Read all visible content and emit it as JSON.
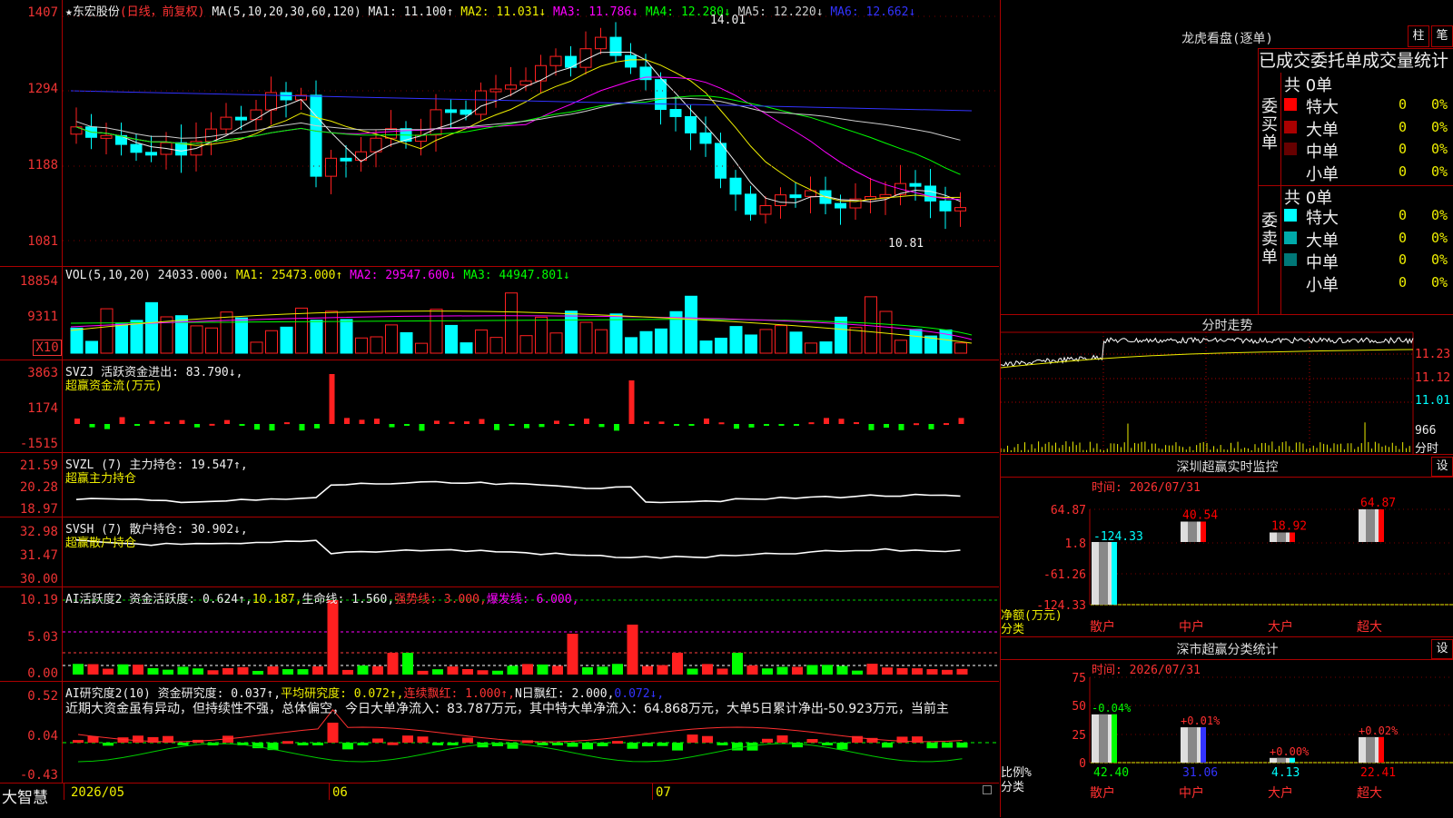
{
  "stock": {
    "star": "★",
    "name": "东宏股份",
    "mode": "(日线，前复权)"
  },
  "main": {
    "ma_prefix": "MA(5,10,20,30,60,120)",
    "ma": [
      {
        "label": "MA1:",
        "value": "11.100↑",
        "color": "#eeeeee"
      },
      {
        "label": "MA2:",
        "value": "11.031↓",
        "color": "#eeee00"
      },
      {
        "label": "MA3:",
        "value": "11.786↓",
        "color": "#ff00ff"
      },
      {
        "label": "MA4:",
        "value": "12.280↓",
        "color": "#00ff00"
      },
      {
        "label": "MA5:",
        "value": "12.220↓",
        "color": "#cccccc"
      },
      {
        "label": "MA6:",
        "value": "12.662↓",
        "color": "#3333ff"
      }
    ],
    "y_labels": [
      "1407",
      "1294",
      "1188",
      "1081"
    ],
    "high_note": "14.01",
    "low_note": "10.81"
  },
  "vol": {
    "legend_prefix": "VOL(5,10,20)",
    "legend_val": "24033.000↓",
    "ma": [
      {
        "label": "MA1:",
        "value": "25473.000↑",
        "color": "#eeee00"
      },
      {
        "label": "MA2:",
        "value": "29547.600↓",
        "color": "#ff00ff"
      },
      {
        "label": "MA3:",
        "value": "44947.801↓",
        "color": "#00ff00"
      }
    ],
    "y_labels": [
      "18854",
      "9311"
    ],
    "unit": "X10"
  },
  "svzj": {
    "legend": "SVZJ  活跃资金进出: 83.790↓,",
    "sub": "超赢资金流(万元)",
    "y_labels": [
      "3863",
      "1174",
      "-1515"
    ]
  },
  "svzl": {
    "legend": "SVZL (7) 主力持仓: 19.547↑,",
    "sub": "超赢主力持仓",
    "y_labels": [
      "21.59",
      "20.28",
      "18.97"
    ]
  },
  "svsh": {
    "legend": "SVSH (7) 散户持仓: 30.902↓,",
    "sub": "超赢散户持仓",
    "y_labels": [
      "32.98",
      "31.47",
      "30.00"
    ]
  },
  "ai_active": {
    "legend_a": "AI活跃度2 资金活跃度: 0.624↑,",
    "legend_b": "10.187,",
    "legend_c": "生命线: 1.560,",
    "legend_d": "强势线: 3.000,",
    "legend_e": "爆发线: 6.000,",
    "y_labels": [
      "10.19",
      "5.03",
      "0.00"
    ]
  },
  "ai_research": {
    "legend_a": "AI研究度2(10) 资金研究度: 0.037↑,",
    "legend_b": "平均研究度: 0.072↑,",
    "legend_c": "连续飘红: 1.000↑,",
    "legend_d": "N日飘红: 2.000,",
    "legend_e": "0.072↓,",
    "text": "近期大资金虽有异动，但持续性不强，总体偏空，今日大单净流入：83.787万元，其中特大单净流入：64.868万元，大单5日累计净出-50.923万元，当前主",
    "y_labels": [
      "0.52",
      "0.04",
      "-0.43"
    ]
  },
  "footer": {
    "brand": "大智慧",
    "dates": [
      "2026/05",
      "06",
      "07"
    ]
  },
  "lhb": {
    "title": "龙虎看盘(逐单)",
    "btn_a": "柱",
    "btn_b": "笔",
    "subtitle": "已成交委托单成交量统计",
    "buy_label": "委买单",
    "sell_label": "委卖单",
    "buy_total": "共 0单",
    "sell_total": "共 0单",
    "buy_rows": [
      {
        "name": "特大",
        "count": "0",
        "pct": "0%",
        "color": "#ff0000"
      },
      {
        "name": "大单",
        "count": "0",
        "pct": "0%",
        "color": "#aa0000"
      },
      {
        "name": "中单",
        "count": "0",
        "pct": "0%",
        "color": "#660000"
      },
      {
        "name": "小单",
        "count": "0",
        "pct": "0%",
        "color": "#000000"
      }
    ],
    "sell_rows": [
      {
        "name": "特大",
        "count": "0",
        "pct": "0%",
        "color": "#00ffff"
      },
      {
        "name": "大单",
        "count": "0",
        "pct": "0%",
        "color": "#00aaaa"
      },
      {
        "name": "中单",
        "count": "0",
        "pct": "0%",
        "color": "#007777"
      },
      {
        "name": "小单",
        "count": "0",
        "pct": "0%",
        "color": "#000000"
      }
    ]
  },
  "fenshi": {
    "title": "分时走势",
    "price_labels": [
      "11.23",
      "11.12",
      "11.01"
    ],
    "vol_labels": [
      "966",
      "分时"
    ]
  },
  "sz_monitor": {
    "title": "深圳超赢实时监控",
    "btn": "设",
    "time": "时间: 2026/07/31",
    "y_labels": [
      "64.87",
      "1.8",
      "-61.26",
      "-124.33"
    ],
    "axis_title_a": "净额(万元)",
    "axis_title_b": "分类",
    "chart_data": {
      "type": "bar",
      "categories": [
        "散户",
        "中户",
        "大户",
        "超大"
      ],
      "values": [
        -124.33,
        40.54,
        18.92,
        64.87
      ],
      "labels": [
        "-124.33",
        "40.54",
        "18.92",
        "64.87"
      ],
      "ylim": [
        -124.33,
        64.87
      ],
      "colors": [
        "#00ffff",
        "#ff0000",
        "#ff0000",
        "#ff0000"
      ]
    }
  },
  "sz_class": {
    "title": "深市超赢分类统计",
    "btn": "设",
    "time": "时间: 2026/07/31",
    "y_labels": [
      "75",
      "50",
      "25",
      "0"
    ],
    "axis_title_a": "比例%",
    "axis_title_b": "分类",
    "chart_data": {
      "type": "bar",
      "categories": [
        "散户",
        "中户",
        "大户",
        "超大"
      ],
      "values": [
        42.4,
        31.06,
        4.13,
        22.41
      ],
      "labels": [
        "42.40",
        "31.06",
        "4.13",
        "22.41"
      ],
      "change_labels": [
        "-0.04%",
        "+0.01%",
        "+0.00%",
        "+0.02%"
      ],
      "ylim": [
        0,
        75
      ],
      "colors": [
        "#00ff00",
        "#3333ff",
        "#00ffff",
        "#ff0000"
      ]
    }
  }
}
